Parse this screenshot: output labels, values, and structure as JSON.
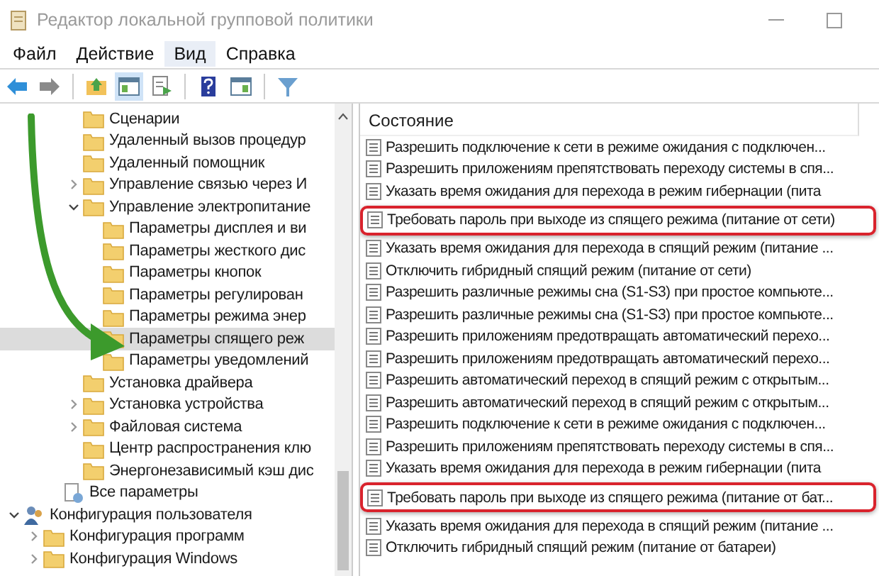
{
  "window": {
    "title": "Редактор локальной групповой политики"
  },
  "menu": [
    {
      "label": "Файл",
      "selected": false
    },
    {
      "label": "Действие",
      "selected": false
    },
    {
      "label": "Вид",
      "selected": true
    },
    {
      "label": "Справка",
      "selected": false
    }
  ],
  "toolbar": [
    {
      "kind": "back",
      "pressed": false
    },
    {
      "kind": "forward",
      "pressed": false
    },
    {
      "kind": "sep"
    },
    {
      "kind": "up",
      "pressed": false
    },
    {
      "kind": "tree",
      "pressed": true
    },
    {
      "kind": "export",
      "pressed": false
    },
    {
      "kind": "sep"
    },
    {
      "kind": "help",
      "pressed": false
    },
    {
      "kind": "pane",
      "pressed": false
    },
    {
      "kind": "sep"
    },
    {
      "kind": "filter",
      "pressed": false
    }
  ],
  "tree": [
    {
      "children": [
        {
          "children": [
            {
              "children": [
                {
                  "label": "Сценарии",
                  "kind": "folder",
                  "selected": false
                },
                {
                  "label": "Удаленный вызов процедур",
                  "kind": "folder",
                  "selected": false
                },
                {
                  "label": "Удаленный помощник",
                  "kind": "folder",
                  "selected": false
                },
                {
                  "label": "Управление связью через И",
                  "kind": "folder",
                  "selected": false,
                  "expanded": false
                },
                {
                  "label": "Управление электропитание",
                  "kind": "folder",
                  "selected": false,
                  "expanded": true,
                  "children": [
                    {
                      "label": "Параметры дисплея и ви",
                      "kind": "folder",
                      "selected": false
                    },
                    {
                      "label": "Параметры жесткого дис",
                      "kind": "folder",
                      "selected": false
                    },
                    {
                      "label": "Параметры кнопок",
                      "kind": "folder",
                      "selected": false
                    },
                    {
                      "label": "Параметры регулирован",
                      "kind": "folder",
                      "selected": false
                    },
                    {
                      "label": "Параметры режима энер",
                      "kind": "folder",
                      "selected": false
                    },
                    {
                      "label": "Параметры спящего реж",
                      "kind": "folder",
                      "selected": true
                    },
                    {
                      "label": "Параметры уведомлений",
                      "kind": "folder",
                      "selected": false
                    }
                  ]
                },
                {
                  "label": "Установка драйвера",
                  "kind": "folder",
                  "selected": false
                },
                {
                  "label": "Установка устройства",
                  "kind": "folder",
                  "selected": false,
                  "expanded": false
                },
                {
                  "label": "Файловая система",
                  "kind": "folder",
                  "selected": false,
                  "expanded": false
                },
                {
                  "label": "Центр распространения клю",
                  "kind": "folder",
                  "selected": false
                },
                {
                  "label": "Энергонезависимый кэш дис",
                  "kind": "folder",
                  "selected": false
                }
              ]
            },
            {
              "label": "Все параметры",
              "kind": "all-settings",
              "selected": false
            }
          ]
        }
      ]
    },
    {
      "label": "Конфигурация пользователя",
      "kind": "user",
      "selected": false,
      "expanded": true,
      "children": [
        {
          "label": "Конфигурация программ",
          "kind": "folder",
          "selected": false,
          "expanded": false
        },
        {
          "label": "Конфигурация Windows",
          "kind": "folder",
          "selected": false,
          "expanded": false
        }
      ]
    }
  ],
  "list": {
    "header": "Состояние",
    "rows": [
      {
        "text": "Разрешить подключение к сети в режиме ожидания с подключен...",
        "highlighted": false
      },
      {
        "text": "Разрешить приложениям препятствовать переходу системы в спя...",
        "highlighted": false
      },
      {
        "text": "Указать время ожидания для перехода в режим гибернации (пита",
        "highlighted": false
      },
      {
        "text": "Требовать пароль при выходе из спящего режима (питание от сети)",
        "highlighted": true
      },
      {
        "text": "Указать время ожидания для перехода в спящий режим (питание ...",
        "highlighted": false
      },
      {
        "text": "Отключить гибридный спящий режим (питание от сети)",
        "highlighted": false
      },
      {
        "text": "Разрешить различные режимы сна (S1-S3) при простое компьюте...",
        "highlighted": false
      },
      {
        "text": "Разрешить различные режимы сна (S1-S3) при простое компьюте...",
        "highlighted": false
      },
      {
        "text": "Разрешить приложениям предотвращать автоматический перехо...",
        "highlighted": false
      },
      {
        "text": "Разрешить приложениям предотвращать автоматический перехо...",
        "highlighted": false
      },
      {
        "text": "Разрешить автоматический переход в спящий режим с открытым...",
        "highlighted": false
      },
      {
        "text": "Разрешить автоматический переход в спящий режим с открытым...",
        "highlighted": false
      },
      {
        "text": "Разрешить подключение к сети в режиме ожидания с подключен...",
        "highlighted": false
      },
      {
        "text": "Разрешить приложениям препятствовать переходу системы в спя...",
        "highlighted": false
      },
      {
        "text": "Указать время ожидания для перехода в режим гибернации (пита",
        "highlighted": false
      },
      {
        "text": "Требовать пароль при выходе из спящего режима (питание от бат...",
        "highlighted": true
      },
      {
        "text": "Указать время ожидания для перехода в спящий режим (питание ...",
        "highlighted": false
      },
      {
        "text": "Отключить гибридный спящий режим (питание от батареи)",
        "highlighted": false
      }
    ]
  }
}
